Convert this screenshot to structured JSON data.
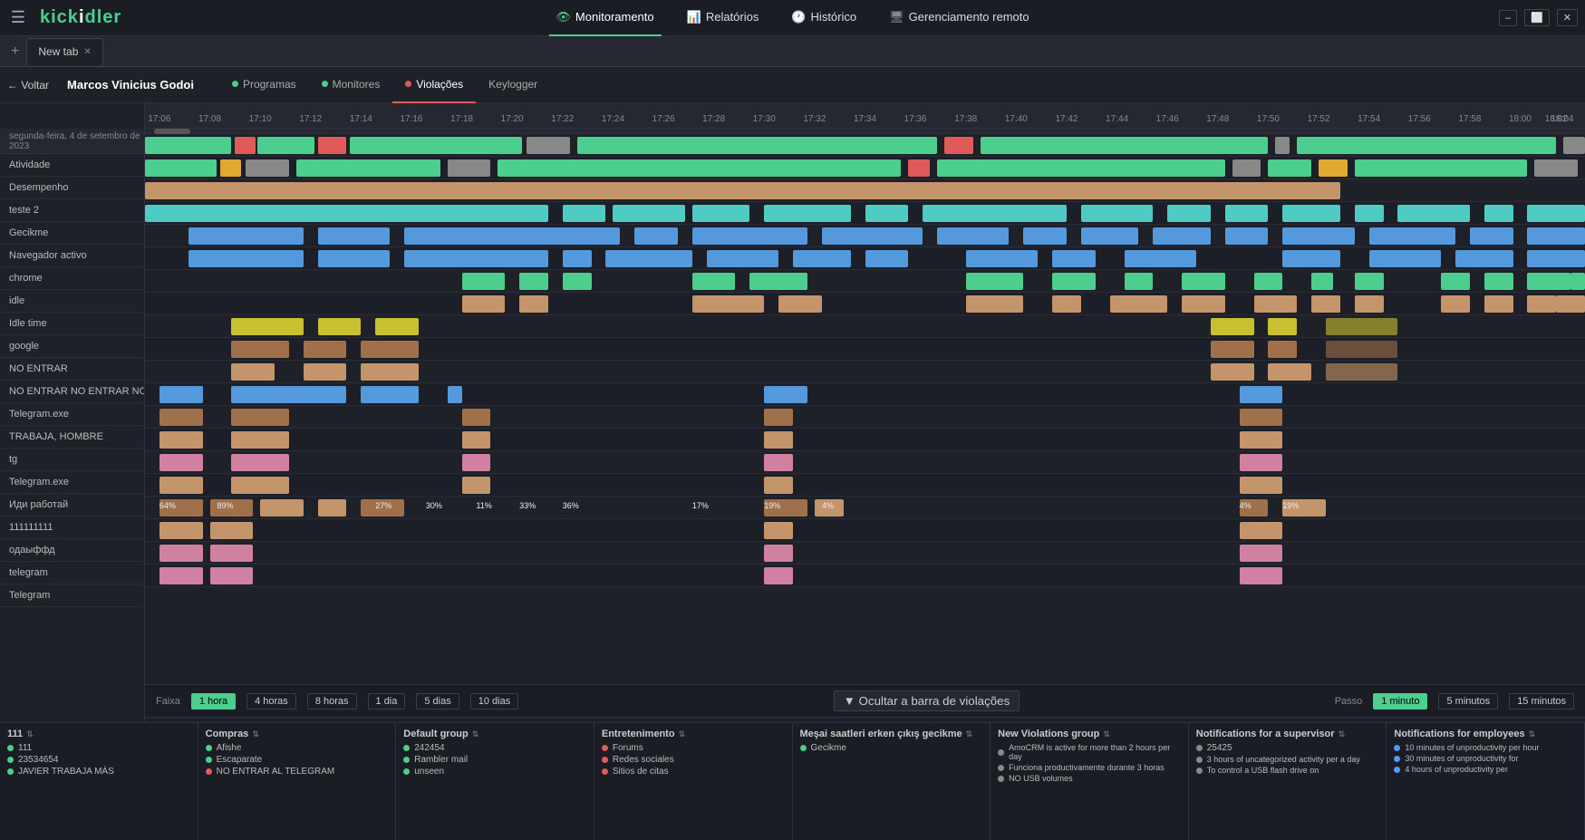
{
  "nav": {
    "hamburger": "☰",
    "logo_k": "kick",
    "logo_i": "i",
    "logo_dler": "dler",
    "items": [
      {
        "label": "Monitoramento",
        "icon": "monitor",
        "active": true
      },
      {
        "label": "Relatórios",
        "icon": "report",
        "active": false
      },
      {
        "label": "Histórico",
        "icon": "history",
        "active": false
      },
      {
        "label": "Gerenciamento remoto",
        "icon": "remote",
        "active": false
      }
    ]
  },
  "tab_bar": {
    "new_tab_label": "New tab",
    "add_icon": "+"
  },
  "user_nav": {
    "back_label": "← Voltar",
    "user_name": "Marcos Vinicius Godoi",
    "tabs": [
      {
        "label": "Programas",
        "dot_color": "#4cce8e",
        "active": false
      },
      {
        "label": "Monitores",
        "dot_color": "#4cce8e",
        "active": false
      },
      {
        "label": "Violações",
        "dot_color": "#e05a5a",
        "active": true
      },
      {
        "label": "Keylogger",
        "dot_color": null,
        "active": false
      }
    ]
  },
  "timeline": {
    "date_label": "segunda-feira, 4 de setembro de 2023",
    "times": [
      "17:06",
      "17:08",
      "17:10",
      "17:12",
      "17:14",
      "17:16",
      "17:18",
      "17:20",
      "17:22",
      "17:24",
      "17:26",
      "17:28",
      "17:30",
      "17:32",
      "17:34",
      "17:36",
      "17:38",
      "17:40",
      "17:42",
      "17:44",
      "17:46",
      "17:48",
      "17:50",
      "17:52",
      "17:54",
      "17:56",
      "17:58",
      "18:00",
      "18:02",
      "18:04"
    ],
    "rows": [
      {
        "label": "Atividade"
      },
      {
        "label": "Desempenho"
      },
      {
        "label": "teste 2"
      },
      {
        "label": "Gecikme"
      },
      {
        "label": "Navegador activo"
      },
      {
        "label": "chrome"
      },
      {
        "label": "idle"
      },
      {
        "label": "Idle time"
      },
      {
        "label": "google"
      },
      {
        "label": "NO ENTRAR"
      },
      {
        "label": "NO ENTRAR NO ENTRAR NO E..."
      },
      {
        "label": "Telegram.exe"
      },
      {
        "label": "TRABAJA, HOMBRE"
      },
      {
        "label": "tg"
      },
      {
        "label": "Telegram.exe"
      },
      {
        "label": "Иди работай"
      },
      {
        "label": "111111111"
      },
      {
        "label": "одаыффд"
      },
      {
        "label": "telegram"
      },
      {
        "label": "Telegram"
      }
    ]
  },
  "controls": {
    "faixa_label": "Faixa",
    "range_buttons": [
      "1 hora",
      "4 horas",
      "8 horas",
      "1 dia",
      "5 dias",
      "10 dias"
    ],
    "active_range": "1 hora",
    "passo_label": "Passo",
    "step_buttons": [
      "1 minuto",
      "5 minutos",
      "15 minutos"
    ],
    "active_step": "1 minuto",
    "hide_button": "▼ Ocultar a barra de violações"
  },
  "groups": [
    {
      "title": "111",
      "items": [
        {
          "label": "111",
          "color": "#4cce8e"
        },
        {
          "label": "23534654",
          "color": "#4cce8e"
        },
        {
          "label": "JAVIER TRABAJA MÁS",
          "color": "#4cce8e"
        }
      ]
    },
    {
      "title": "Compras",
      "items": [
        {
          "label": "Afishe",
          "color": "#4cce8e"
        },
        {
          "label": "Escaparate",
          "color": "#4cce8e"
        },
        {
          "label": "NO ENTRAR AL TELEGRAM",
          "color": "#e05a5a"
        }
      ]
    },
    {
      "title": "Default group",
      "items": [
        {
          "label": "242454",
          "color": "#4cce8e"
        },
        {
          "label": "Rambler mail",
          "color": "#4cce8e"
        },
        {
          "label": "unseen",
          "color": "#4cce8e"
        }
      ]
    },
    {
      "title": "Entretenimento",
      "items": [
        {
          "label": "Forums",
          "color": "#e05a5a"
        },
        {
          "label": "Redes sociales",
          "color": "#e05a5a"
        },
        {
          "label": "Sitios de citas",
          "color": "#e05a5a"
        }
      ]
    },
    {
      "title": "Meşai saatleri erken çıkış gecikme",
      "items": [
        {
          "label": "Gecikme",
          "color": "#4cce8e"
        }
      ]
    },
    {
      "title": "New Violations group",
      "items": [
        {
          "label": "AmoCRM is active for more than 2 hours per day",
          "color": "#888"
        },
        {
          "label": "Funciona productivamente durante 3 horas",
          "color": "#888"
        },
        {
          "label": "NO USB volumes",
          "color": "#888"
        }
      ]
    },
    {
      "title": "Notifications for a supervisor",
      "items": [
        {
          "label": "25425",
          "color": "#888"
        },
        {
          "label": "3 hours of uncategorized activity per a day",
          "color": "#888"
        },
        {
          "label": "To control a USB flash drive on",
          "color": "#888"
        }
      ]
    },
    {
      "title": "Notifications for employees",
      "items": [
        {
          "label": "10 minutes of unproductivity per hour",
          "color": "#5599ff"
        },
        {
          "label": "30 minutes of unproductivity for",
          "color": "#5599ff"
        },
        {
          "label": "4 hours of unproductivity per",
          "color": "#5599ff"
        }
      ]
    }
  ]
}
